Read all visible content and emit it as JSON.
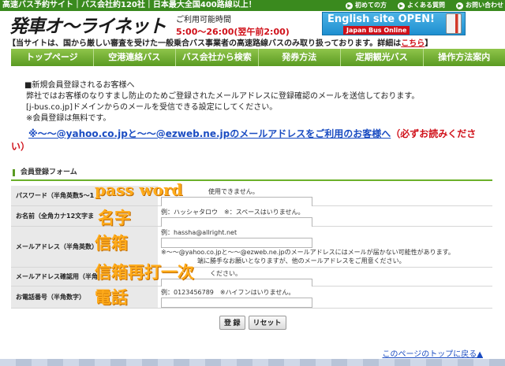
{
  "topbar": {
    "tagline": "高速バス予約サイト｜バス会社約120社｜日本最大全国400路線以上！",
    "links": [
      {
        "label": "初めての方",
        "icon": "arrow-circle-icon"
      },
      {
        "label": "よくある質問",
        "icon": "arrow-circle-icon"
      },
      {
        "label": "お問い合わせ",
        "icon": "arrow-circle-icon"
      }
    ]
  },
  "header": {
    "logo": "発車オ～ライネット",
    "hours_label": "ご利用可能時間",
    "hours_time": "5:00〜26:00(翌午前2:00)",
    "banner_title": "English site OPEN!",
    "banner_sub": "Japan Bus Online"
  },
  "notice": {
    "text": "【当サイトは、国から厳しい審査を受けた一般乗合バス事業者の高速路線バスのみ取り扱っております。詳細は",
    "link": "こちら",
    "end": "】"
  },
  "nav": [
    "トップページ",
    "空港連絡バス",
    "バス会社から検索",
    "発券方法",
    "定期観光バス",
    "操作方法案内"
  ],
  "intro": [
    "■新規会員登録されるお客様へ",
    "弊社ではお客様のなりすまし防止のためご登録されたメールアドレスに登録確認のメールを送信しております。",
    "[j-bus.co.jp]ドメインからのメールを受信できる設定にしてください。",
    "※会員登録は無料です。"
  ],
  "warning": {
    "link": "※〜〜@yahoo.co.jpと〜〜@ezweb.ne.jpのメールアドレスをご利用のお客様へ",
    "tail": "（必ずお読みくださ",
    "tail2": "い）"
  },
  "form": {
    "section_title": "会員登録フォーム",
    "rows": [
      {
        "label": "パスワード（半角英数5〜1",
        "hint_top": "使用できません。",
        "hint": ""
      },
      {
        "label": "お名前（全角カナ12文字ま",
        "hint_top": "例：ハッシャタロウ　※：スペースはいりません。",
        "hint": ""
      },
      {
        "label": "メールアドレス（半角英数）",
        "hint_top": "例：hassha@allright.net",
        "hint": "※〜〜@yahoo.co.jpと〜〜@ezweb.ne.jpのメールアドレスにはメールが届かない可能性があります。",
        "hint2": "端に勝手なお願いとなりますが、他のメールアドレスをご用意ください。"
      },
      {
        "label": "メールアドレス確認用（半角",
        "hint_top": "ください。",
        "hint": ""
      },
      {
        "label": "お電話番号（半角数字）",
        "hint_top": "例：0123456789　※ハイフンはいりません。",
        "hint": ""
      }
    ],
    "annotations": [
      "pass word",
      "名字",
      "信箱",
      "信箱再打一次",
      "電話"
    ]
  },
  "buttons": {
    "submit": "登 録",
    "reset": "リセット"
  },
  "gototop": "このページのトップに戻る▲",
  "colors": {
    "brand_green": "#3a8a1e",
    "nav_green": "#5a9a22",
    "accent_red": "#d0111a",
    "link_blue": "#1a4cc2",
    "annotation_orange": "#ffab1a"
  }
}
